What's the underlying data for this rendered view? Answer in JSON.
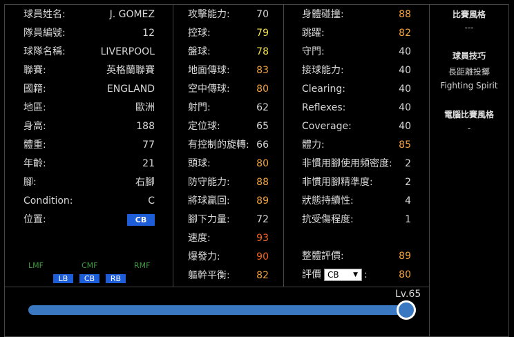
{
  "profile": [
    {
      "label": "球員姓名:",
      "value": "J. GOMEZ"
    },
    {
      "label": "隊員編號:",
      "value": "12"
    },
    {
      "label": "球隊名稱:",
      "value": "LIVERPOOL"
    },
    {
      "label": "聯賽:",
      "value": "英格蘭聯賽"
    },
    {
      "label": "國籍:",
      "value": "ENGLAND"
    },
    {
      "label": "地區:",
      "value": "歐洲"
    },
    {
      "label": "身高:",
      "value": "188"
    },
    {
      "label": "體重:",
      "value": "77"
    },
    {
      "label": "年齡:",
      "value": "21"
    },
    {
      "label": "腳:",
      "value": "右腳"
    },
    {
      "label": "Condition:",
      "value": "C"
    },
    {
      "label": "位置:",
      "value": "CB"
    }
  ],
  "positions": {
    "mid": [
      "LMF",
      "CMF",
      "RMF"
    ],
    "defense": [
      "LB",
      "CB",
      "RB"
    ]
  },
  "stats_mid": [
    {
      "label": "攻擊能力:",
      "value": "70",
      "color": "#d8d8d8"
    },
    {
      "label": "控球:",
      "value": "79",
      "color": "#f2e04a"
    },
    {
      "label": "盤球:",
      "value": "78",
      "color": "#f2e04a"
    },
    {
      "label": "地面傳球:",
      "value": "83",
      "color": "#f5a33c"
    },
    {
      "label": "空中傳球:",
      "value": "80",
      "color": "#f5a33c"
    },
    {
      "label": "射門:",
      "value": "62",
      "color": "#d8d8d8"
    },
    {
      "label": "定位球:",
      "value": "65",
      "color": "#d8d8d8"
    },
    {
      "label": "有控制的旋轉:",
      "value": "66",
      "color": "#d8d8d8"
    },
    {
      "label": "頭球:",
      "value": "80",
      "color": "#f5a33c"
    },
    {
      "label": "防守能力:",
      "value": "88",
      "color": "#f5a33c"
    },
    {
      "label": "將球贏回:",
      "value": "89",
      "color": "#f5a33c"
    },
    {
      "label": "腳下力量:",
      "value": "72",
      "color": "#d8d8d8"
    },
    {
      "label": "速度:",
      "value": "93",
      "color": "#f5661e"
    },
    {
      "label": "爆發力:",
      "value": "90",
      "color": "#f5661e"
    },
    {
      "label": "軀幹平衡:",
      "value": "82",
      "color": "#f5a33c"
    }
  ],
  "stats_right": [
    {
      "label": "身體碰撞:",
      "value": "88",
      "color": "#f5a33c"
    },
    {
      "label": "跳躍:",
      "value": "82",
      "color": "#f5a33c"
    },
    {
      "label": "守門:",
      "value": "40",
      "color": "#d8d8d8"
    },
    {
      "label": "接球能力:",
      "value": "40",
      "color": "#d8d8d8"
    },
    {
      "label": "Clearing:",
      "value": "40",
      "color": "#d8d8d8"
    },
    {
      "label": "Reflexes:",
      "value": "40",
      "color": "#d8d8d8"
    },
    {
      "label": "Coverage:",
      "value": "40",
      "color": "#d8d8d8"
    },
    {
      "label": "體力:",
      "value": "85",
      "color": "#f5a33c"
    },
    {
      "label": "非慣用腳使用頻密度:",
      "value": "2",
      "color": "#d8d8d8"
    },
    {
      "label": "非慣用腳精準度:",
      "value": "2",
      "color": "#d8d8d8"
    },
    {
      "label": "狀態持續性:",
      "value": "4",
      "color": "#d8d8d8"
    },
    {
      "label": "抗受傷程度:",
      "value": "1",
      "color": "#d8d8d8"
    }
  ],
  "overall": {
    "label": "整體評價:",
    "value": "89",
    "color": "#f5a33c"
  },
  "rating": {
    "label": "評價",
    "selected": "CB",
    "colon": ":",
    "value": "80",
    "color": "#f5a33c"
  },
  "side": {
    "style_header": "比賽風格",
    "style_value": "---",
    "skills_header": "球員技巧",
    "skills": [
      "長距離投擲",
      "Fighting Spirit"
    ],
    "com_header": "電腦比賽風格",
    "com_value": "-"
  },
  "level": {
    "label": "Lv.65",
    "value": 65,
    "max": 65
  }
}
